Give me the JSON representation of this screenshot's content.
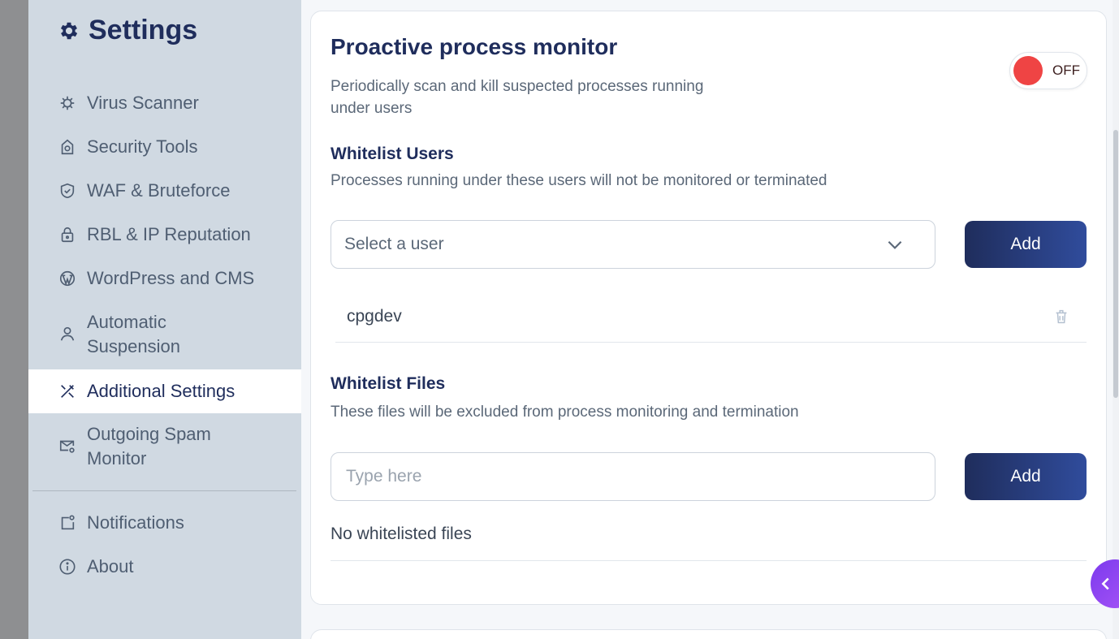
{
  "sidebar": {
    "title": "Settings",
    "items": [
      {
        "label": "Virus Scanner",
        "icon": "virus-icon"
      },
      {
        "label": "Security Tools",
        "icon": "security-icon"
      },
      {
        "label": "WAF & Bruteforce",
        "icon": "shield-icon"
      },
      {
        "label": "RBL & IP Reputation",
        "icon": "lock-icon"
      },
      {
        "label": "WordPress and CMS",
        "icon": "wordpress-icon"
      },
      {
        "label": "Automatic Suspension",
        "icon": "user-icon"
      },
      {
        "label": "Additional Settings",
        "icon": "tools-icon",
        "active": true
      },
      {
        "label": "Outgoing Spam Monitor",
        "icon": "mail-icon"
      },
      {
        "label": "Notifications",
        "icon": "notification-icon"
      },
      {
        "label": "About",
        "icon": "info-icon"
      }
    ]
  },
  "monitor": {
    "title": "Proactive process monitor",
    "description": "Periodically scan and kill suspected processes running under users",
    "toggle_label": "OFF",
    "toggle_state": false
  },
  "whitelist_users": {
    "title": "Whitelist Users",
    "description": "Processes running under these users will not be monitored or terminated",
    "select_placeholder": "Select a user",
    "add_label": "Add",
    "users": [
      "cpgdev"
    ]
  },
  "whitelist_files": {
    "title": "Whitelist Files",
    "description": "These files will be excluded from process monitoring and termination",
    "input_placeholder": "Type here",
    "add_label": "Add",
    "empty_text": "No whitelisted files"
  },
  "colors": {
    "primary": "#1f2d5c",
    "sidebar_bg": "#d0d9e2",
    "toggle_off": "#ef4444",
    "float_button": "#8b3ff0"
  }
}
